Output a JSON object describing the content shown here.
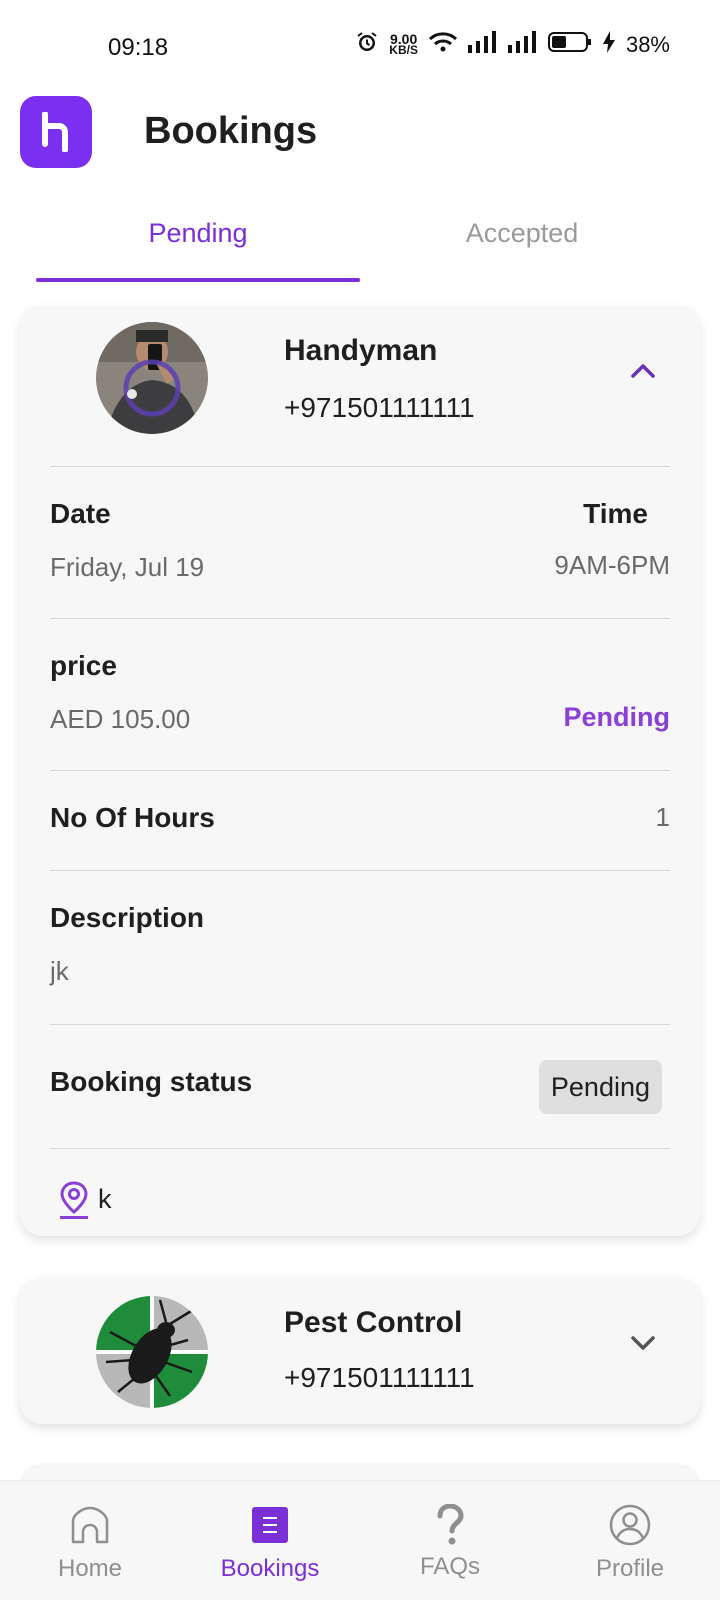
{
  "status_bar": {
    "time": "09:18",
    "speed_value": "9.00",
    "speed_unit": "KB/S",
    "battery": "38%",
    "icons": [
      "alarm-icon",
      "wifi-icon",
      "signal-icon",
      "signal-icon",
      "battery-icon",
      "charging-icon"
    ]
  },
  "header": {
    "title": "Bookings",
    "logo_icon": "app-logo-icon"
  },
  "tabs": [
    {
      "label": "Pending",
      "active": true
    },
    {
      "label": "Accepted",
      "active": false
    }
  ],
  "bookings": [
    {
      "name": "Handyman",
      "phone": "+971501111111",
      "expanded": true,
      "date_label": "Date",
      "date": "Friday, Jul 19",
      "time_label": "Time",
      "time": "9AM-6PM",
      "price_label": "price",
      "price": "AED 105.00",
      "payment_status": "Pending",
      "hours_label": "No Of Hours",
      "hours": "1",
      "description_label": "Description",
      "description": "jk",
      "booking_status_label": "Booking status",
      "booking_status": "Pending",
      "location": "k"
    },
    {
      "name": "Pest Control",
      "phone": "+971501111111",
      "expanded": false
    }
  ],
  "bottom_nav": [
    {
      "label": "Home",
      "icon": "home-icon",
      "active": false
    },
    {
      "label": "Bookings",
      "icon": "bookings-icon",
      "active": true
    },
    {
      "label": "FAQs",
      "icon": "faq-icon",
      "active": false
    },
    {
      "label": "Profile",
      "icon": "profile-icon",
      "active": false
    }
  ],
  "colors": {
    "accent": "#7b2fd6",
    "logo": "#7b2ff0",
    "inactive": "#8f8f8f",
    "card": "#f7f7f7"
  }
}
